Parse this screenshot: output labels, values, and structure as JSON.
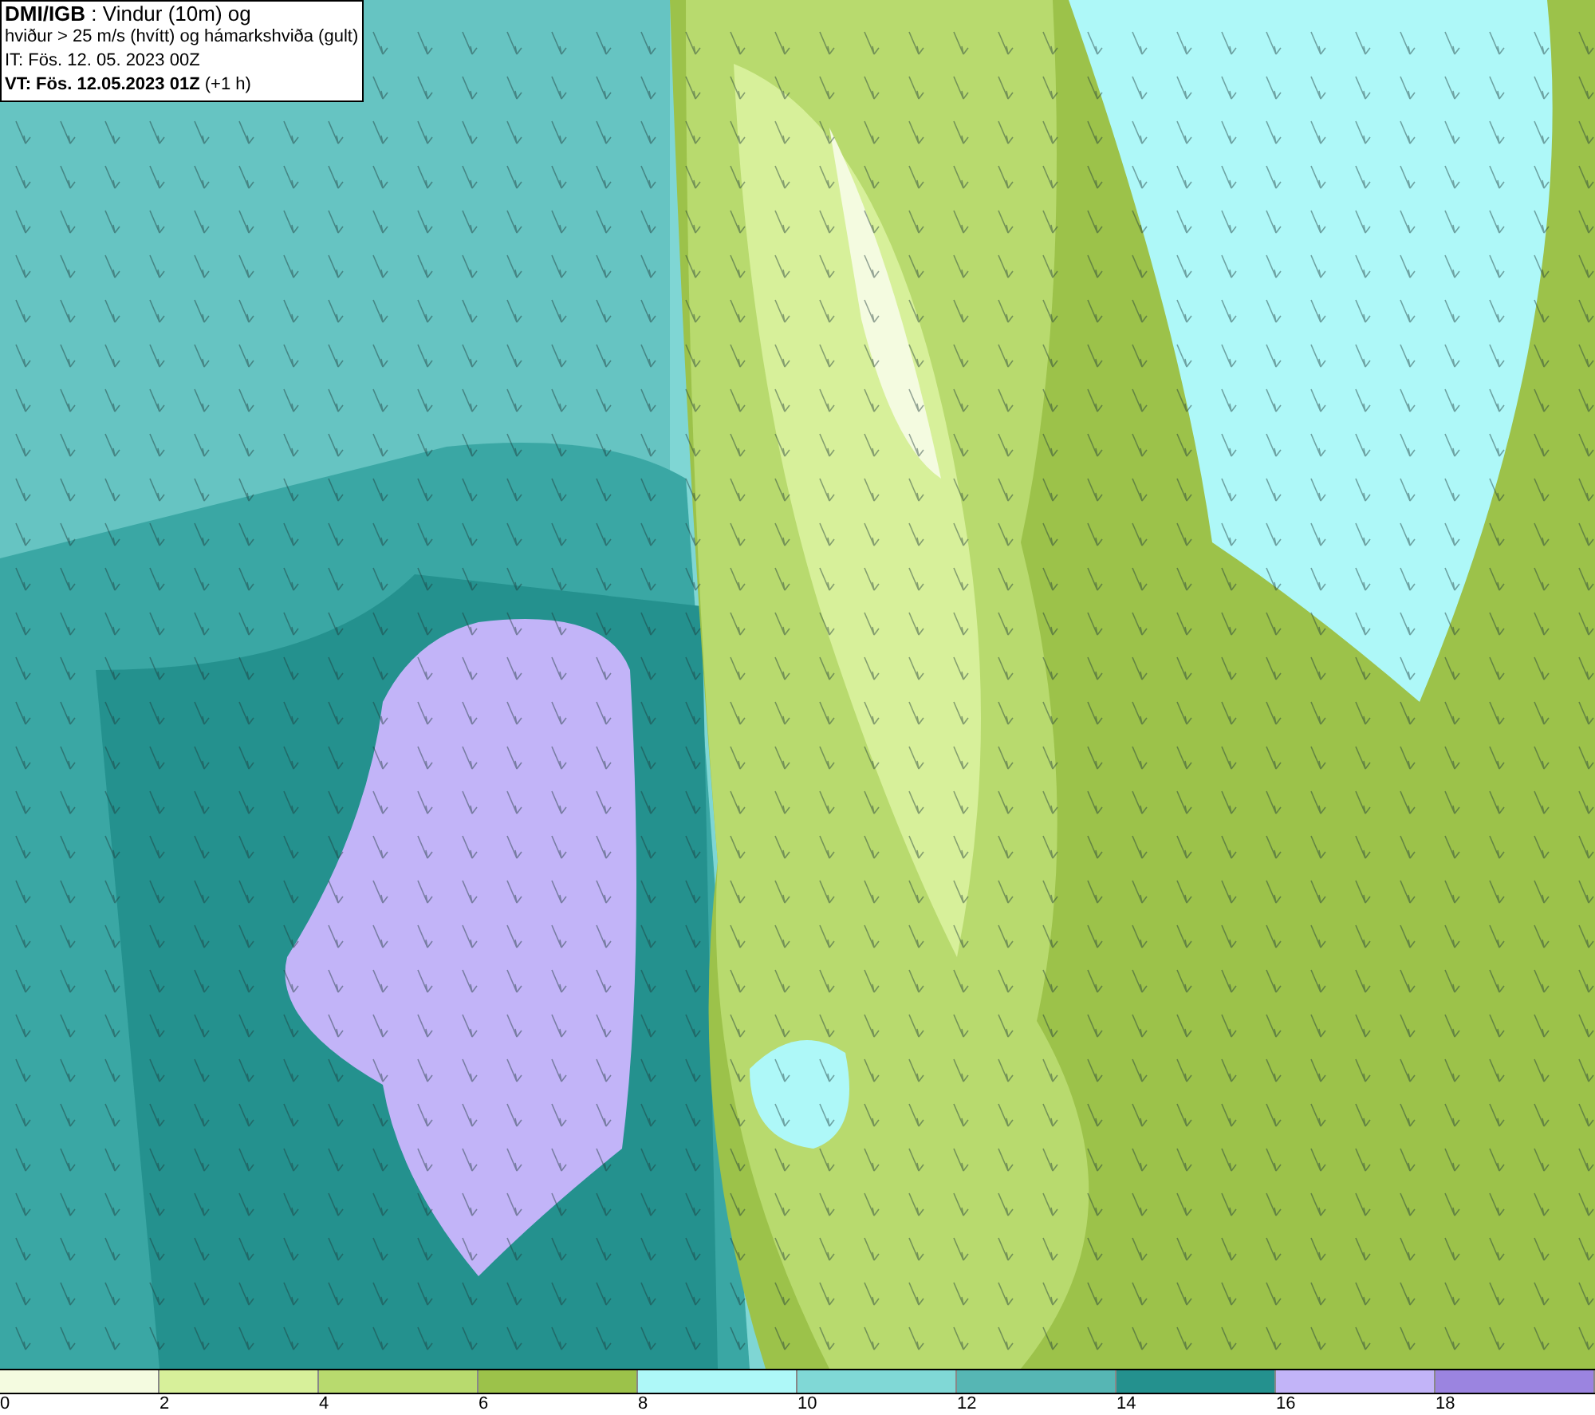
{
  "header": {
    "lines": [
      "**DMI/IGB** : Vindur (10m) og",
      "hviður > 25 m/s (hvítt) og hámarkshviða (gult)",
      "IT: Fös. 12. 05. 2023 00Z",
      "**VT: Fös. 12.05.2023 01Z** (+1 h)"
    ]
  },
  "legend": {
    "colors": [
      {
        "color": "#f4fbe0"
      },
      {
        "color": "#d7f09a"
      },
      {
        "color": "#b8da6e"
      },
      {
        "color": "#9cc24a"
      },
      {
        "color": "#aef8f8"
      },
      {
        "color": "#80d8d6"
      },
      {
        "color": "#56b6b4"
      },
      {
        "color": "#24918e"
      },
      {
        "color": "#c2b4f8"
      },
      {
        "color": "#9b84e0"
      }
    ],
    "ticks": [
      "0",
      "2",
      "4",
      "6",
      "8",
      "10",
      "12",
      "14",
      "16",
      "18"
    ]
  }
}
